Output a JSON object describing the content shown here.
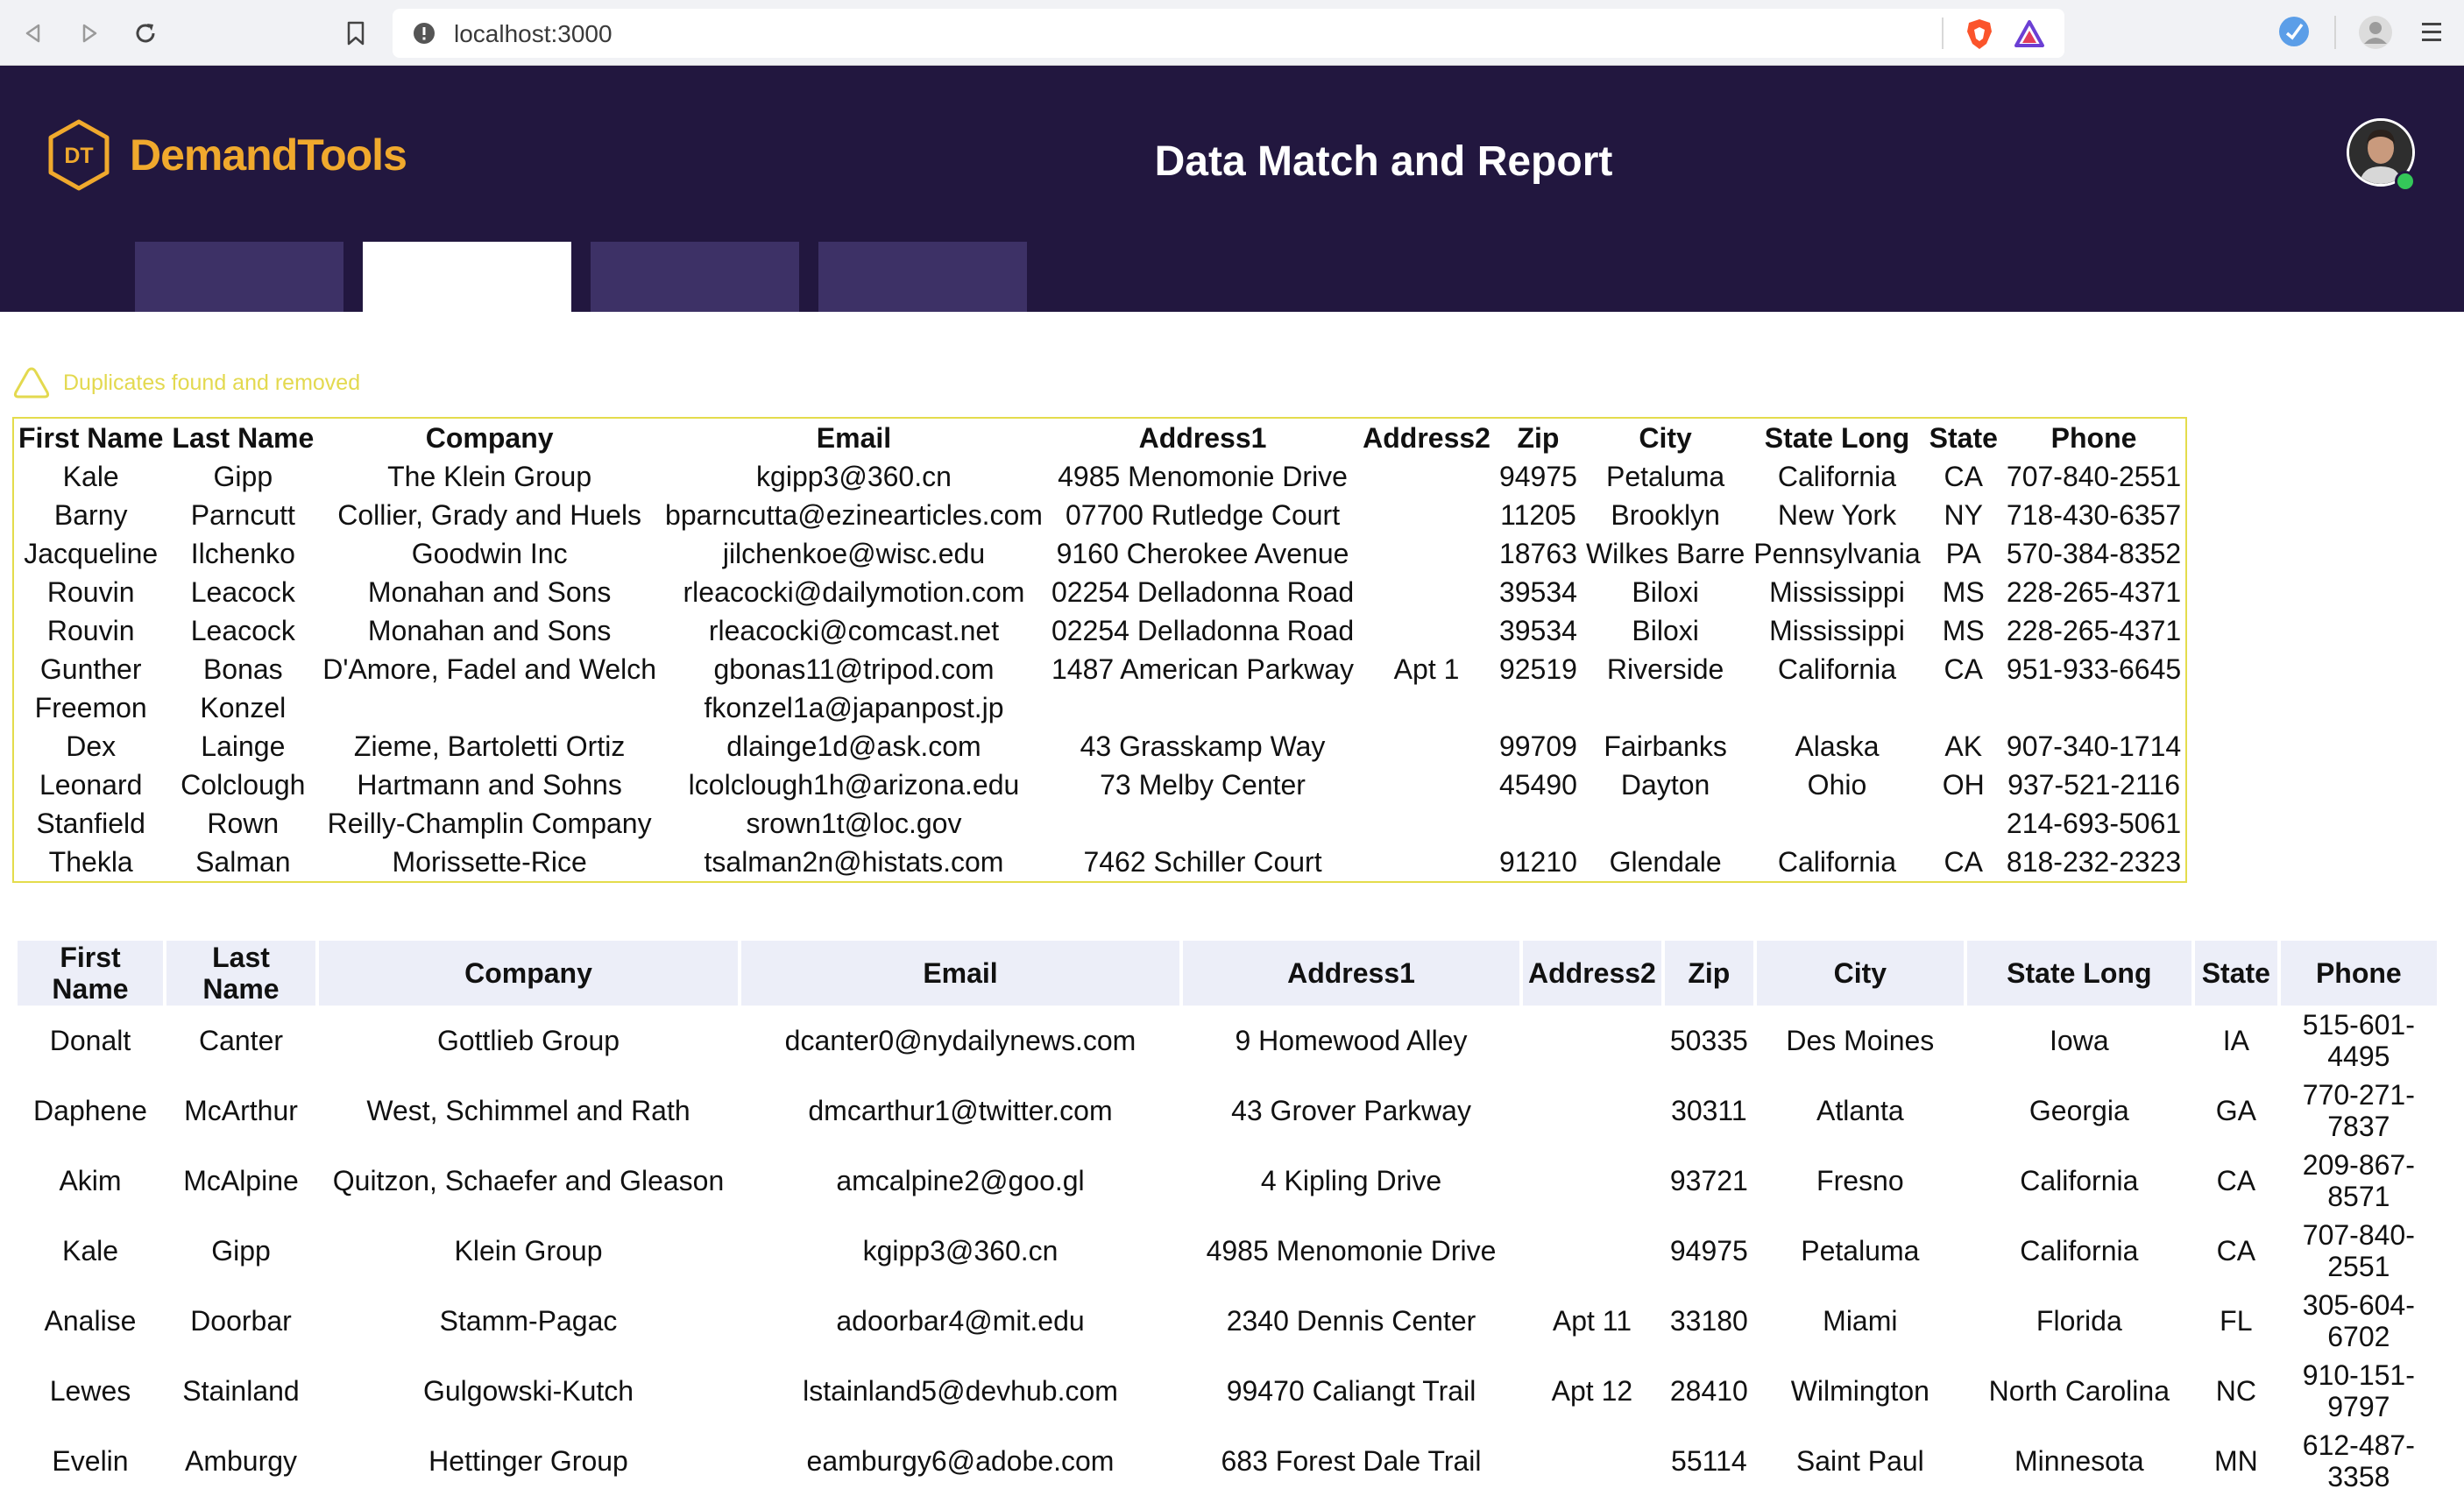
{
  "browser": {
    "url": "localhost:3000"
  },
  "header": {
    "logo_mark": "DT",
    "logo_text": "DemandTools",
    "title": "Data Match and Report",
    "tabs_count_visible": 4
  },
  "notice": {
    "text": "Duplicates found and removed"
  },
  "duplicates": {
    "columns": [
      "First Name",
      "Last Name",
      "Company",
      "Email",
      "Address1",
      "Address2",
      "Zip",
      "City",
      "State Long",
      "State",
      "Phone"
    ],
    "rows": [
      [
        "Kale",
        "Gipp",
        "The Klein Group",
        "kgipp3@360.cn",
        "4985 Menomonie Drive",
        "",
        "94975",
        "Petaluma",
        "California",
        "CA",
        "707-840-2551"
      ],
      [
        "Barny",
        "Parncutt",
        "Collier, Grady and Huels",
        "bparncutta@ezinearticles.com",
        "07700 Rutledge Court",
        "",
        "11205",
        "Brooklyn",
        "New York",
        "NY",
        "718-430-6357"
      ],
      [
        "Jacqueline",
        "Ilchenko",
        "Goodwin Inc",
        "jilchenkoe@wisc.edu",
        "9160 Cherokee Avenue",
        "",
        "18763",
        "Wilkes Barre",
        "Pennsylvania",
        "PA",
        "570-384-8352"
      ],
      [
        "Rouvin",
        "Leacock",
        "Monahan and Sons",
        "rleacocki@dailymotion.com",
        "02254 Delladonna Road",
        "",
        "39534",
        "Biloxi",
        "Mississippi",
        "MS",
        "228-265-4371"
      ],
      [
        "Rouvin",
        "Leacock",
        "Monahan and Sons",
        "rleacocki@comcast.net",
        "02254 Delladonna Road",
        "",
        "39534",
        "Biloxi",
        "Mississippi",
        "MS",
        "228-265-4371"
      ],
      [
        "Gunther",
        "Bonas",
        "D'Amore, Fadel and Welch",
        "gbonas11@tripod.com",
        "1487 American Parkway",
        "Apt 1",
        "92519",
        "Riverside",
        "California",
        "CA",
        "951-933-6645"
      ],
      [
        "Freemon",
        "Konzel",
        "",
        "fkonzel1a@japanpost.jp",
        "",
        "",
        "",
        "",
        "",
        "",
        ""
      ],
      [
        "Dex",
        "Lainge",
        "Zieme, Bartoletti Ortiz",
        "dlainge1d@ask.com",
        "43 Grasskamp Way",
        "",
        "99709",
        "Fairbanks",
        "Alaska",
        "AK",
        "907-340-1714"
      ],
      [
        "Leonard",
        "Colclough",
        "Hartmann and Sohns",
        "lcolclough1h@arizona.edu",
        "73 Melby Center",
        "",
        "45490",
        "Dayton",
        "Ohio",
        "OH",
        "937-521-2116"
      ],
      [
        "Stanfield",
        "Rown",
        "Reilly-Champlin Company",
        "srown1t@loc.gov",
        "",
        "",
        "",
        "",
        "",
        "",
        "214-693-5061"
      ],
      [
        "Thekla",
        "Salman",
        "Morissette-Rice",
        "tsalman2n@histats.com",
        "7462 Schiller Court",
        "",
        "91210",
        "Glendale",
        "California",
        "CA",
        "818-232-2323"
      ]
    ]
  },
  "main_table": {
    "columns": [
      "First Name",
      "Last Name",
      "Company",
      "Email",
      "Address1",
      "Address2",
      "Zip",
      "City",
      "State Long",
      "State",
      "Phone"
    ],
    "rows": [
      [
        "Donalt",
        "Canter",
        "Gottlieb Group",
        "dcanter0@nydailynews.com",
        "9 Homewood Alley",
        "",
        "50335",
        "Des Moines",
        "Iowa",
        "IA",
        "515-601-4495"
      ],
      [
        "Daphene",
        "McArthur",
        "West, Schimmel and Rath",
        "dmcarthur1@twitter.com",
        "43 Grover Parkway",
        "",
        "30311",
        "Atlanta",
        "Georgia",
        "GA",
        "770-271-7837"
      ],
      [
        "Akim",
        "McAlpine",
        "Quitzon, Schaefer and Gleason",
        "amcalpine2@goo.gl",
        "4 Kipling Drive",
        "",
        "93721",
        "Fresno",
        "California",
        "CA",
        "209-867-8571"
      ],
      [
        "Kale",
        "Gipp",
        "Klein Group",
        "kgipp3@360.cn",
        "4985 Menomonie Drive",
        "",
        "94975",
        "Petaluma",
        "California",
        "CA",
        "707-840-2551"
      ],
      [
        "Analise",
        "Doorbar",
        "Stamm-Pagac",
        "adoorbar4@mit.edu",
        "2340 Dennis Center",
        "Apt 11",
        "33180",
        "Miami",
        "Florida",
        "FL",
        "305-604-6702"
      ],
      [
        "Lewes",
        "Stainland",
        "Gulgowski-Kutch",
        "lstainland5@devhub.com",
        "99470 Caliangt Trail",
        "Apt 12",
        "28410",
        "Wilmington",
        "North Carolina",
        "NC",
        "910-151-9797"
      ],
      [
        "Evelin",
        "Amburgy",
        "Hettinger Group",
        "eamburgy6@adobe.com",
        "683 Forest Dale Trail",
        "",
        "55114",
        "Saint Paul",
        "Minnesota",
        "MN",
        "612-487-3358"
      ]
    ]
  }
}
